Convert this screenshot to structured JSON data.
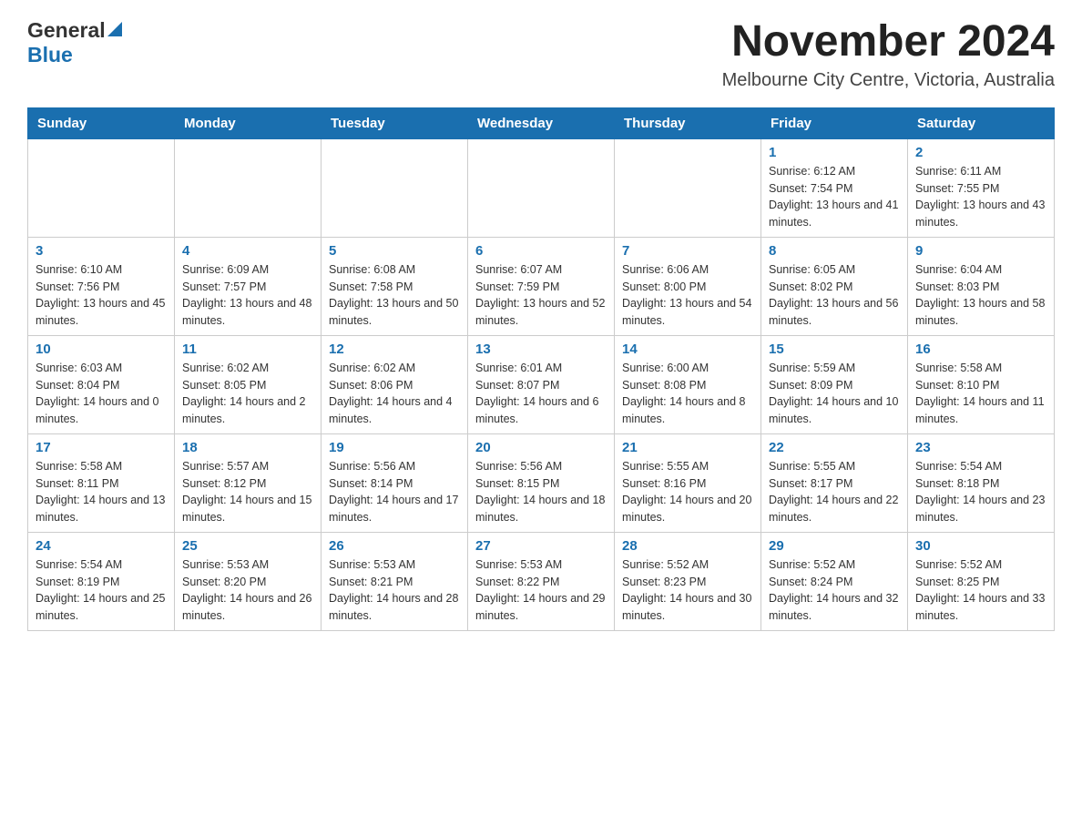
{
  "logo": {
    "general": "General",
    "blue": "Blue"
  },
  "header": {
    "month_title": "November 2024",
    "location": "Melbourne City Centre, Victoria, Australia"
  },
  "weekdays": [
    "Sunday",
    "Monday",
    "Tuesday",
    "Wednesday",
    "Thursday",
    "Friday",
    "Saturday"
  ],
  "weeks": [
    [
      {
        "day": "",
        "info": ""
      },
      {
        "day": "",
        "info": ""
      },
      {
        "day": "",
        "info": ""
      },
      {
        "day": "",
        "info": ""
      },
      {
        "day": "",
        "info": ""
      },
      {
        "day": "1",
        "info": "Sunrise: 6:12 AM\nSunset: 7:54 PM\nDaylight: 13 hours and 41 minutes."
      },
      {
        "day": "2",
        "info": "Sunrise: 6:11 AM\nSunset: 7:55 PM\nDaylight: 13 hours and 43 minutes."
      }
    ],
    [
      {
        "day": "3",
        "info": "Sunrise: 6:10 AM\nSunset: 7:56 PM\nDaylight: 13 hours and 45 minutes."
      },
      {
        "day": "4",
        "info": "Sunrise: 6:09 AM\nSunset: 7:57 PM\nDaylight: 13 hours and 48 minutes."
      },
      {
        "day": "5",
        "info": "Sunrise: 6:08 AM\nSunset: 7:58 PM\nDaylight: 13 hours and 50 minutes."
      },
      {
        "day": "6",
        "info": "Sunrise: 6:07 AM\nSunset: 7:59 PM\nDaylight: 13 hours and 52 minutes."
      },
      {
        "day": "7",
        "info": "Sunrise: 6:06 AM\nSunset: 8:00 PM\nDaylight: 13 hours and 54 minutes."
      },
      {
        "day": "8",
        "info": "Sunrise: 6:05 AM\nSunset: 8:02 PM\nDaylight: 13 hours and 56 minutes."
      },
      {
        "day": "9",
        "info": "Sunrise: 6:04 AM\nSunset: 8:03 PM\nDaylight: 13 hours and 58 minutes."
      }
    ],
    [
      {
        "day": "10",
        "info": "Sunrise: 6:03 AM\nSunset: 8:04 PM\nDaylight: 14 hours and 0 minutes."
      },
      {
        "day": "11",
        "info": "Sunrise: 6:02 AM\nSunset: 8:05 PM\nDaylight: 14 hours and 2 minutes."
      },
      {
        "day": "12",
        "info": "Sunrise: 6:02 AM\nSunset: 8:06 PM\nDaylight: 14 hours and 4 minutes."
      },
      {
        "day": "13",
        "info": "Sunrise: 6:01 AM\nSunset: 8:07 PM\nDaylight: 14 hours and 6 minutes."
      },
      {
        "day": "14",
        "info": "Sunrise: 6:00 AM\nSunset: 8:08 PM\nDaylight: 14 hours and 8 minutes."
      },
      {
        "day": "15",
        "info": "Sunrise: 5:59 AM\nSunset: 8:09 PM\nDaylight: 14 hours and 10 minutes."
      },
      {
        "day": "16",
        "info": "Sunrise: 5:58 AM\nSunset: 8:10 PM\nDaylight: 14 hours and 11 minutes."
      }
    ],
    [
      {
        "day": "17",
        "info": "Sunrise: 5:58 AM\nSunset: 8:11 PM\nDaylight: 14 hours and 13 minutes."
      },
      {
        "day": "18",
        "info": "Sunrise: 5:57 AM\nSunset: 8:12 PM\nDaylight: 14 hours and 15 minutes."
      },
      {
        "day": "19",
        "info": "Sunrise: 5:56 AM\nSunset: 8:14 PM\nDaylight: 14 hours and 17 minutes."
      },
      {
        "day": "20",
        "info": "Sunrise: 5:56 AM\nSunset: 8:15 PM\nDaylight: 14 hours and 18 minutes."
      },
      {
        "day": "21",
        "info": "Sunrise: 5:55 AM\nSunset: 8:16 PM\nDaylight: 14 hours and 20 minutes."
      },
      {
        "day": "22",
        "info": "Sunrise: 5:55 AM\nSunset: 8:17 PM\nDaylight: 14 hours and 22 minutes."
      },
      {
        "day": "23",
        "info": "Sunrise: 5:54 AM\nSunset: 8:18 PM\nDaylight: 14 hours and 23 minutes."
      }
    ],
    [
      {
        "day": "24",
        "info": "Sunrise: 5:54 AM\nSunset: 8:19 PM\nDaylight: 14 hours and 25 minutes."
      },
      {
        "day": "25",
        "info": "Sunrise: 5:53 AM\nSunset: 8:20 PM\nDaylight: 14 hours and 26 minutes."
      },
      {
        "day": "26",
        "info": "Sunrise: 5:53 AM\nSunset: 8:21 PM\nDaylight: 14 hours and 28 minutes."
      },
      {
        "day": "27",
        "info": "Sunrise: 5:53 AM\nSunset: 8:22 PM\nDaylight: 14 hours and 29 minutes."
      },
      {
        "day": "28",
        "info": "Sunrise: 5:52 AM\nSunset: 8:23 PM\nDaylight: 14 hours and 30 minutes."
      },
      {
        "day": "29",
        "info": "Sunrise: 5:52 AM\nSunset: 8:24 PM\nDaylight: 14 hours and 32 minutes."
      },
      {
        "day": "30",
        "info": "Sunrise: 5:52 AM\nSunset: 8:25 PM\nDaylight: 14 hours and 33 minutes."
      }
    ]
  ]
}
